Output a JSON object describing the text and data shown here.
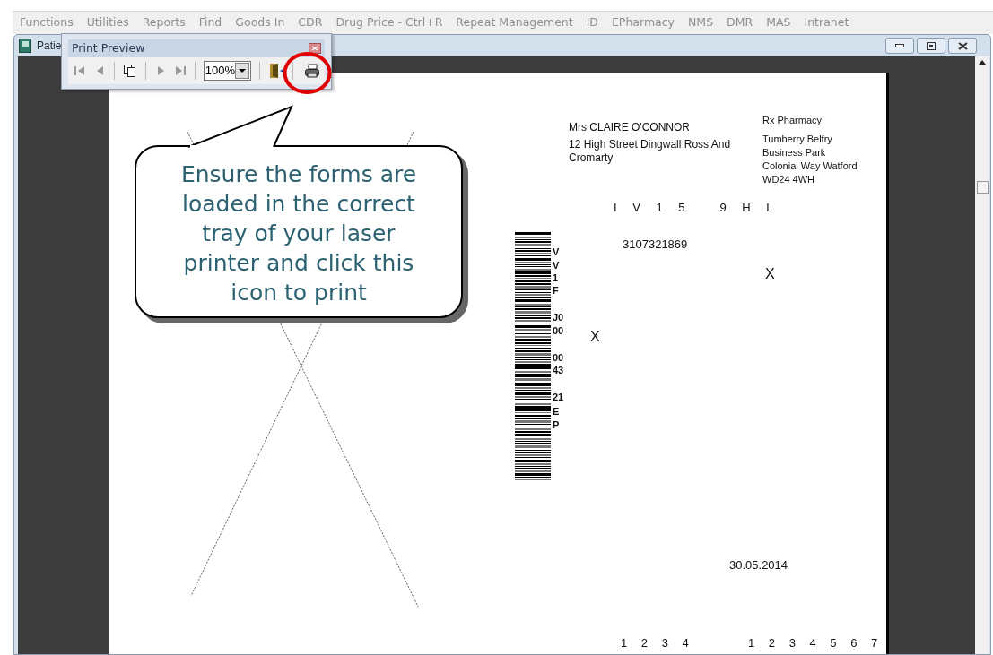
{
  "menu_bar": {
    "items": [
      "Functions",
      "Utilities",
      "Reports",
      "Find",
      "Goods In",
      "CDR",
      "Drug Price - Ctrl+R",
      "Repeat Management",
      "ID",
      "EPharmacy",
      "NMS",
      "DMR",
      "MAS",
      "Intranet"
    ]
  },
  "window": {
    "title": "Patie"
  },
  "print_preview_toolbar": {
    "title": "Print Preview",
    "zoom": "100%"
  },
  "callout": {
    "text": "Ensure the forms are loaded in the correct tray of your laser printer and click this icon to print"
  },
  "form": {
    "patient_name": "Mrs CLAIRE O'CONNOR",
    "patient_address": "12 High Street Dingwall Ross And Cromarty",
    "pharmacy_name": "Rx Pharmacy",
    "pharmacy_address": [
      "Tumberry Belfry",
      "Business Park",
      "Colonial Way Watford",
      "WD24 4WH"
    ],
    "postcode": "I V 1 5   9 H L",
    "number": "3107321869",
    "marks": [
      "X",
      "X"
    ],
    "barcode_labels": [
      "V",
      "V",
      "1",
      "F",
      "J0",
      "00",
      "00",
      "43",
      "21",
      "E",
      "P"
    ],
    "date": "30.05.2014",
    "boxes_left": "1 2 3 4",
    "boxes_right": "1 2 3 4 5 6 7"
  }
}
